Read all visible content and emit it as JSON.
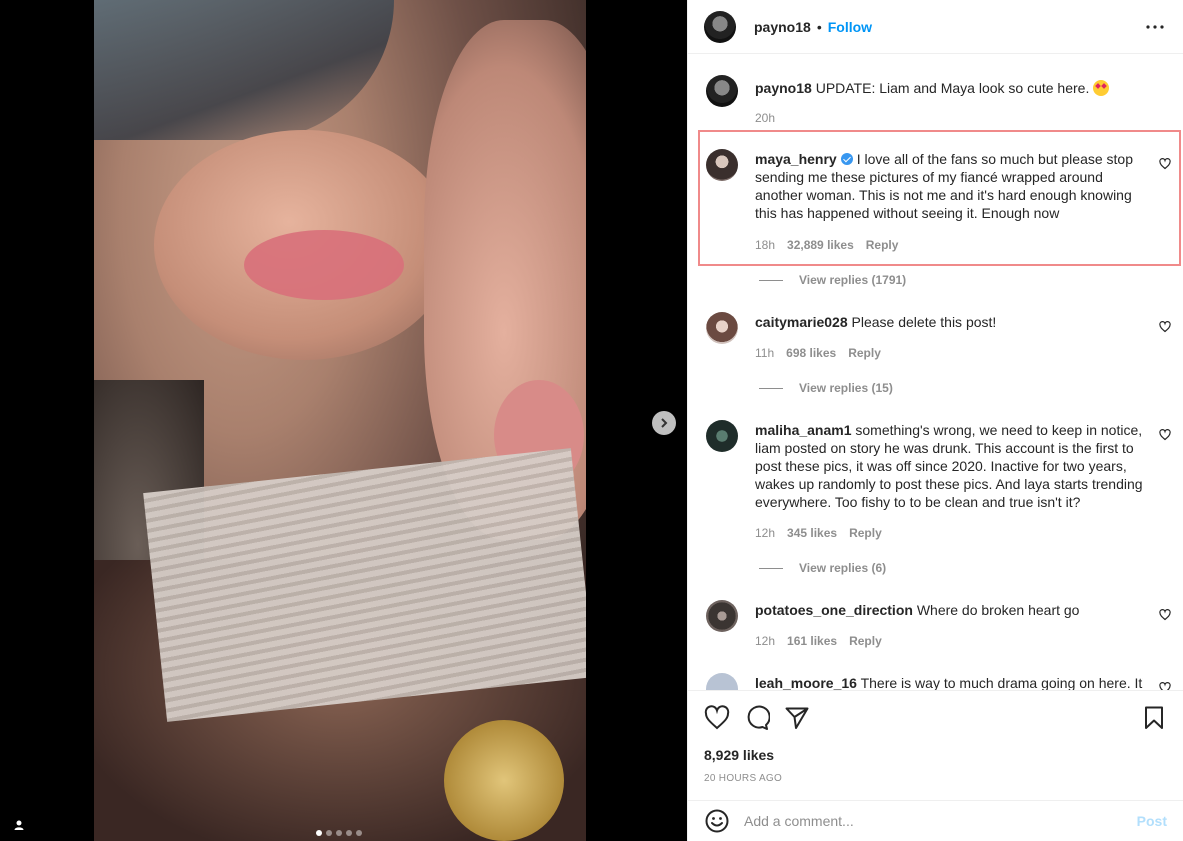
{
  "post": {
    "author": "payno18",
    "separator": "•",
    "follow_label": "Follow",
    "caption_user": "payno18",
    "caption_text": "UPDATE: Liam and Maya look so cute here.",
    "caption_time": "20h",
    "likes": "8,929 likes",
    "posted_ago": "20 HOURS AGO",
    "carousel_count": 5,
    "carousel_active": 0
  },
  "comments": [
    {
      "user": "maya_henry",
      "verified": true,
      "text": "I love all of the fans so much but please stop sending me these pictures of my fiancé wrapped around another woman. This is not me and it's hard enough knowing this has happened without seeing it. Enough now",
      "time": "18h",
      "likes": "32,889 likes",
      "reply": "Reply",
      "view_replies": "View replies (1791)",
      "highlighted": true
    },
    {
      "user": "caitymarie028",
      "text": "Please delete this post!",
      "time": "11h",
      "likes": "698 likes",
      "reply": "Reply",
      "view_replies": "View replies (15)"
    },
    {
      "user": "maliha_anam1",
      "text": "something's wrong, we need to keep in notice, liam posted on story he was drunk. This account is the first to post these pics, it was off since 2020. Inactive for two years, wakes up randomly to post these pics. And laya starts trending everywhere. Too fishy to to be clean and true isn't it?",
      "time": "12h",
      "likes": "345 likes",
      "reply": "Reply",
      "view_replies": "View replies (6)"
    },
    {
      "user": "potatoes_one_direction",
      "text": "Where do broken heart go",
      "time": "12h",
      "likes": "161 likes",
      "reply": "Reply"
    },
    {
      "user": "leah_moore_16",
      "text": "There is way to much drama going on here. It's"
    }
  ],
  "composer": {
    "placeholder": "Add a comment...",
    "post_label": "Post"
  },
  "icons": {
    "more": "more-horizontal-icon",
    "like": "heart-icon",
    "comment": "comment-bubble-icon",
    "share": "paper-plane-icon",
    "save": "bookmark-icon",
    "emoji": "smiley-icon",
    "next": "chevron-right-icon",
    "tagged": "user-tag-icon"
  },
  "colors": {
    "accent": "#0095f6",
    "post_disabled": "#b2dffc",
    "highlight_border": "#f08a8a",
    "muted": "#8e8e8e"
  }
}
